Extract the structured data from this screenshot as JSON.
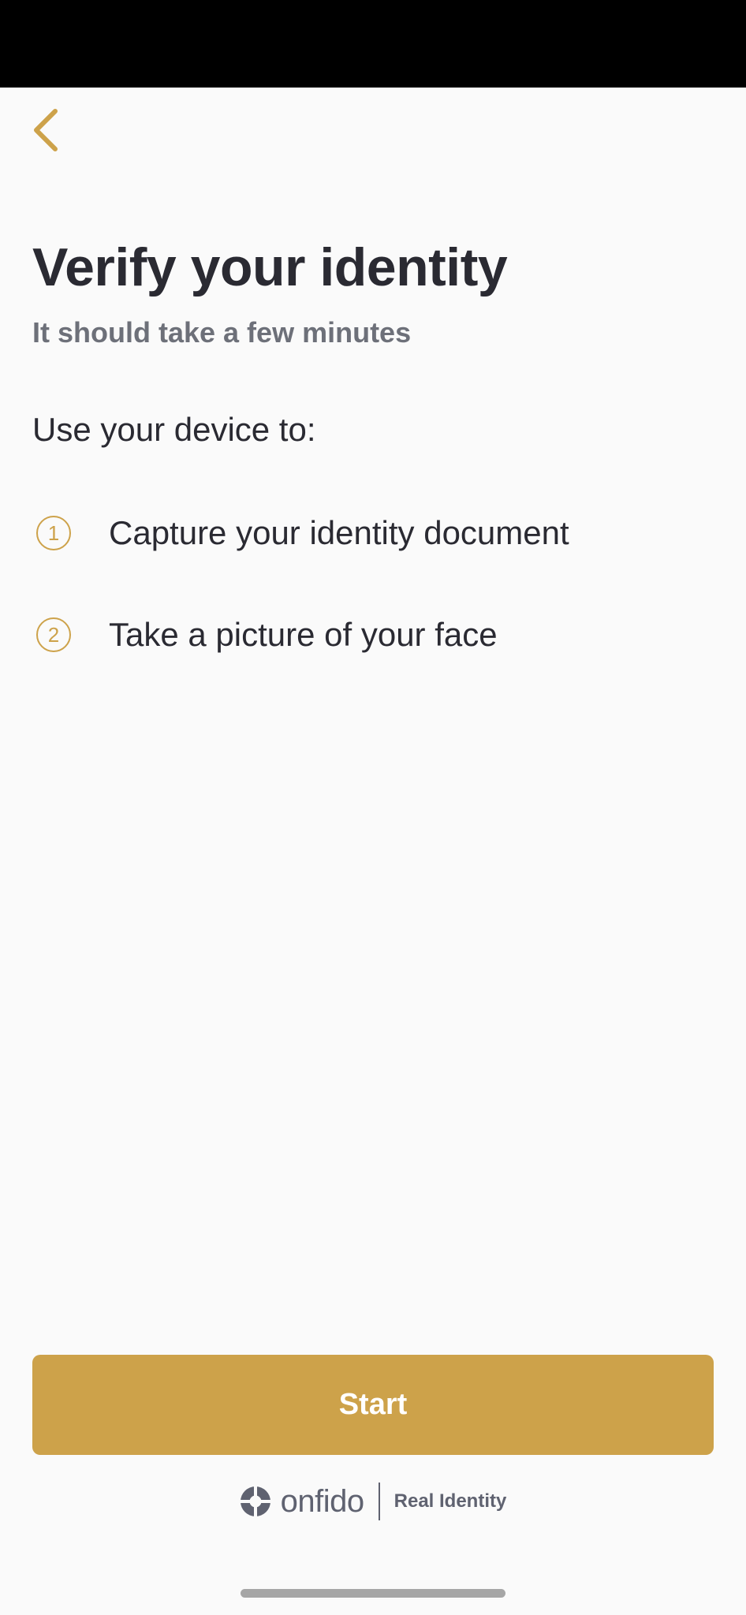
{
  "header": {
    "back_icon": "chevron-left-icon"
  },
  "intro": {
    "title": "Verify your identity",
    "subtitle": "It should take a few minutes",
    "lead": "Use your device to:"
  },
  "steps": [
    {
      "number": "1",
      "label": "Capture your identity document"
    },
    {
      "number": "2",
      "label": "Take a picture of your face"
    }
  ],
  "actions": {
    "start_label": "Start"
  },
  "footer": {
    "brand_icon": "onfido-logo-icon",
    "brand_name": "onfido",
    "tagline": "Real Identity"
  },
  "colors": {
    "accent": "#cda24a",
    "title_text": "#2a2a32",
    "subtitle_text": "#6d7079",
    "background": "#fafafa",
    "status_bar": "#000000"
  }
}
